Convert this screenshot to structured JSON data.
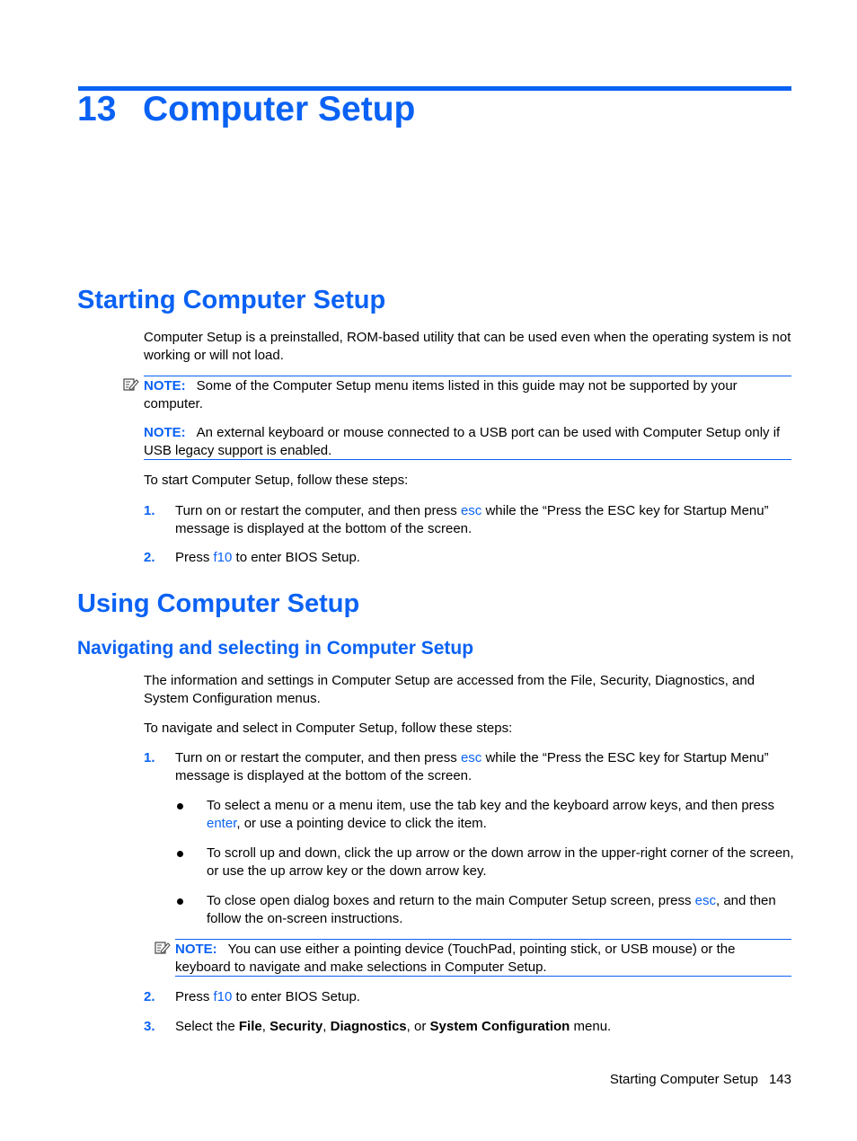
{
  "chapter": {
    "number": "13",
    "title": "Computer Setup"
  },
  "section_starting": {
    "heading": "Starting Computer Setup",
    "intro": "Computer Setup is a preinstalled, ROM-based utility that can be used even when the operating system is not working or will not load.",
    "notes": [
      {
        "label": "NOTE:",
        "text": "Some of the Computer Setup menu items listed in this guide may not be supported by your computer."
      },
      {
        "label": "NOTE:",
        "text": "An external keyboard or mouse connected to a USB port can be used with Computer Setup only if USB legacy support is enabled."
      }
    ],
    "steps_intro": "To start Computer Setup, follow these steps:",
    "steps": [
      {
        "num": "1.",
        "before": "Turn on or restart the computer, and then press ",
        "key": "esc",
        "after": " while the “Press the ESC key for Startup Menu” message is displayed at the bottom of the screen."
      },
      {
        "num": "2.",
        "before": "Press ",
        "key": "f10",
        "after": " to enter BIOS Setup."
      }
    ]
  },
  "section_using": {
    "heading": "Using Computer Setup",
    "subheading": "Navigating and selecting in Computer Setup",
    "intro": "The information and settings in Computer Setup are accessed from the File, Security, Diagnostics, and System Configuration menus.",
    "steps_intro": "To navigate and select in Computer Setup, follow these steps:",
    "step1": {
      "num": "1.",
      "before": "Turn on or restart the computer, and then press ",
      "key": "esc",
      "after": " while the “Press the ESC key for Startup Menu” message is displayed at the bottom of the screen."
    },
    "bullets": [
      {
        "before": "To select a menu or a menu item, use the tab key and the keyboard arrow keys, and then press ",
        "key": "enter",
        "after": ", or use a pointing device to click the item."
      },
      {
        "before": "To scroll up and down, click the up arrow or the down arrow in the upper-right corner of the screen, or use the up arrow key or the down arrow key.",
        "key": "",
        "after": ""
      },
      {
        "before": "To close open dialog boxes and return to the main Computer Setup screen, press ",
        "key": "esc",
        "after": ", and then follow the on-screen instructions."
      }
    ],
    "note": {
      "label": "NOTE:",
      "text": "You can use either a pointing device (TouchPad, pointing stick, or USB mouse) or the keyboard to navigate and make selections in Computer Setup."
    },
    "step2": {
      "num": "2.",
      "before": "Press ",
      "key": "f10",
      "after": " to enter BIOS Setup."
    },
    "step3": {
      "num": "3.",
      "t1": "Select the ",
      "b1": "File",
      "t2": ", ",
      "b2": "Security",
      "t3": ", ",
      "b3": "Diagnostics",
      "t4": ", or ",
      "b4": "System Configuration",
      "t5": " menu."
    }
  },
  "footer": {
    "section": "Starting Computer Setup",
    "page": "143"
  },
  "colors": {
    "accent": "#0a62f5"
  }
}
